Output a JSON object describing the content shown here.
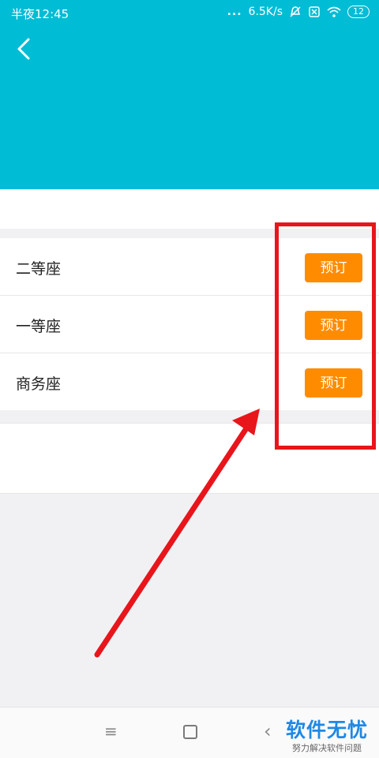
{
  "status_bar": {
    "time": "半夜12:45",
    "dots": "...",
    "speed": "6.5K/s",
    "battery": "12",
    "icons": [
      "mute-icon",
      "sim-x-icon",
      "wifi-icon",
      "battery-icon"
    ]
  },
  "header": {
    "color": "#00bcd4",
    "back_icon": "chevron-left-icon"
  },
  "seats": [
    {
      "name": "二等座",
      "action": "预订"
    },
    {
      "name": "一等座",
      "action": "预订"
    },
    {
      "name": "商务座",
      "action": "预订"
    }
  ],
  "annotation": {
    "color": "#e8151b"
  },
  "nav_bar": {
    "menu": "≡",
    "back": "‹",
    "icons": [
      "menu-icon",
      "home-icon",
      "back-icon"
    ]
  },
  "watermark": {
    "title": "软件无忧",
    "subtitle": "努力解决软件问题"
  },
  "colors": {
    "book_button": "#ff8c00",
    "background": "#f1f1f3"
  }
}
